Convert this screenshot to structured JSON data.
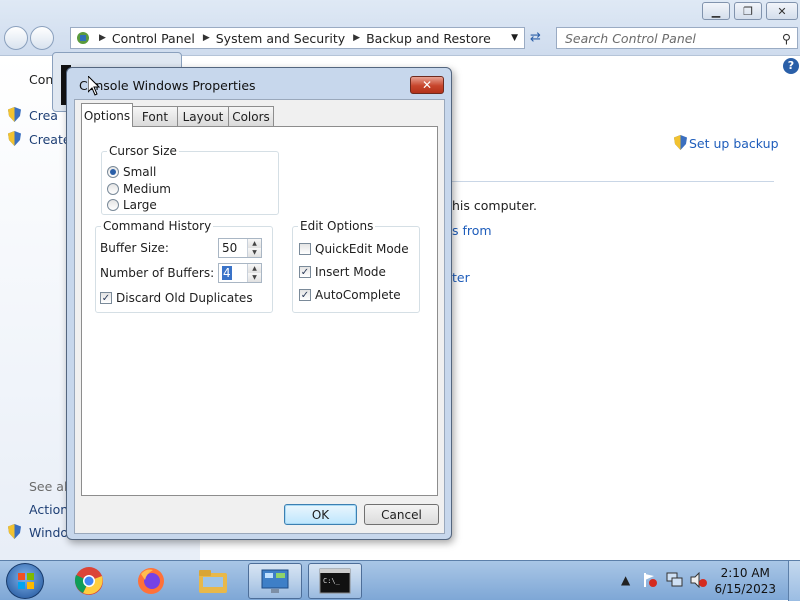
{
  "explorer": {
    "breadcrumb": [
      "Control Panel",
      "System and Security",
      "Backup and Restore"
    ],
    "search_placeholder": "Search Control Panel",
    "left_pane": {
      "control_fragment": "Con",
      "create1_fragment": "Crea",
      "create2_fragment": "Create",
      "see_also_fragment": "See als",
      "action_fragment": "Action",
      "windows_fragment": "Windo"
    },
    "main": {
      "setup_backup": "Set up backup",
      "this_computer_fragment": "his computer.",
      "files_from_fragment": "s from",
      "ter_fragment": "ter"
    }
  },
  "dialog": {
    "title": "Console Windows Properties",
    "close_glyph": "✕",
    "tabs": [
      "Options",
      "Font",
      "Layout",
      "Colors"
    ],
    "cursor_size": {
      "title": "Cursor Size",
      "options": [
        "Small",
        "Medium",
        "Large"
      ],
      "selected": "Small"
    },
    "command_history": {
      "title": "Command History",
      "buffer_size_label": "Buffer Size:",
      "buffer_size_value": "50",
      "num_buffers_label": "Number of Buffers:",
      "num_buffers_value": "4",
      "discard_label": "Discard Old Duplicates",
      "discard_checked": true
    },
    "edit_options": {
      "title": "Edit Options",
      "quickedit_label": "QuickEdit Mode",
      "quickedit_checked": false,
      "insert_label": "Insert Mode",
      "insert_checked": true,
      "autocomplete_label": "AutoComplete",
      "autocomplete_checked": true
    },
    "ok_label": "OK",
    "cancel_label": "Cancel"
  },
  "taskbar": {
    "time": "2:10 AM",
    "date": "6/15/2023",
    "tray_arrow": "▲"
  },
  "colors": {
    "accent": "#1e5dbb",
    "taskbar": "#8fb3dd",
    "close_red": "#c7452c"
  }
}
